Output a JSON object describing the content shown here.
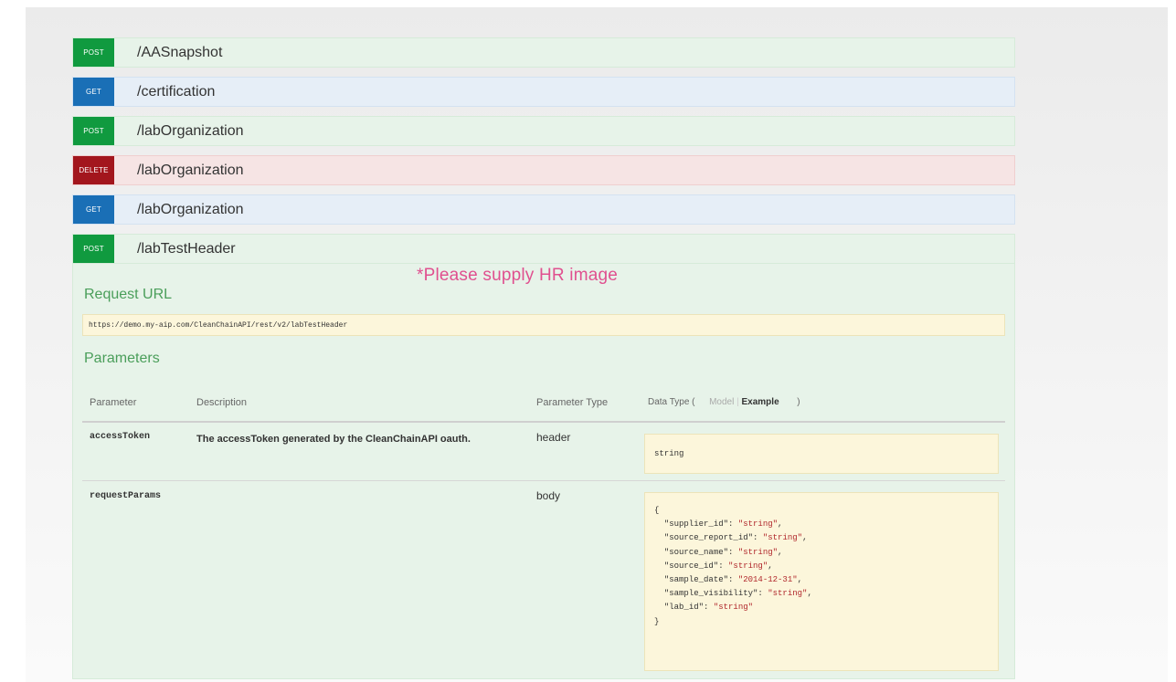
{
  "operations": [
    {
      "method": "POST",
      "path": "/AASnapshot"
    },
    {
      "method": "GET",
      "path": "/certification"
    },
    {
      "method": "POST",
      "path": "/labOrganization"
    },
    {
      "method": "DELETE",
      "path": "/labOrganization"
    },
    {
      "method": "GET",
      "path": "/labOrganization"
    },
    {
      "method": "POST",
      "path": "/labTestHeader"
    }
  ],
  "note": "*Please supply HR image",
  "detail": {
    "request_url_title": "Request URL",
    "request_url": "https://demo.my-aip.com/CleanChainAPI/rest/v2/labTestHeader",
    "parameters_title": "Parameters",
    "columns": {
      "parameter": "Parameter",
      "description": "Description",
      "parameter_type": "Parameter Type",
      "data_type": "Data Type (",
      "model": "Model",
      "example": "Example",
      "close_paren": ")"
    },
    "rows": [
      {
        "name": "accessToken",
        "description": "The accessToken generated by the CleanChainAPI oauth.",
        "type": "header",
        "example": "string"
      },
      {
        "name": "requestParams",
        "description": "",
        "type": "body",
        "json_open": "{",
        "json_close": "}",
        "json_fields": [
          {
            "key": "\"supplier_id\": ",
            "value": "\"string\"",
            "comma": ","
          },
          {
            "key": "\"source_report_id\": ",
            "value": "\"string\"",
            "comma": ","
          },
          {
            "key": "\"source_name\": ",
            "value": "\"string\"",
            "comma": ","
          },
          {
            "key": "\"source_id\": ",
            "value": "\"string\"",
            "comma": ","
          },
          {
            "key": "\"sample_date\": ",
            "value": "\"2014-12-31\"",
            "comma": ","
          },
          {
            "key": "\"sample_visibility\": ",
            "value": "\"string\"",
            "comma": ","
          },
          {
            "key": "\"lab_id\": ",
            "value": "\"string\"",
            "comma": ""
          }
        ]
      }
    ]
  }
}
